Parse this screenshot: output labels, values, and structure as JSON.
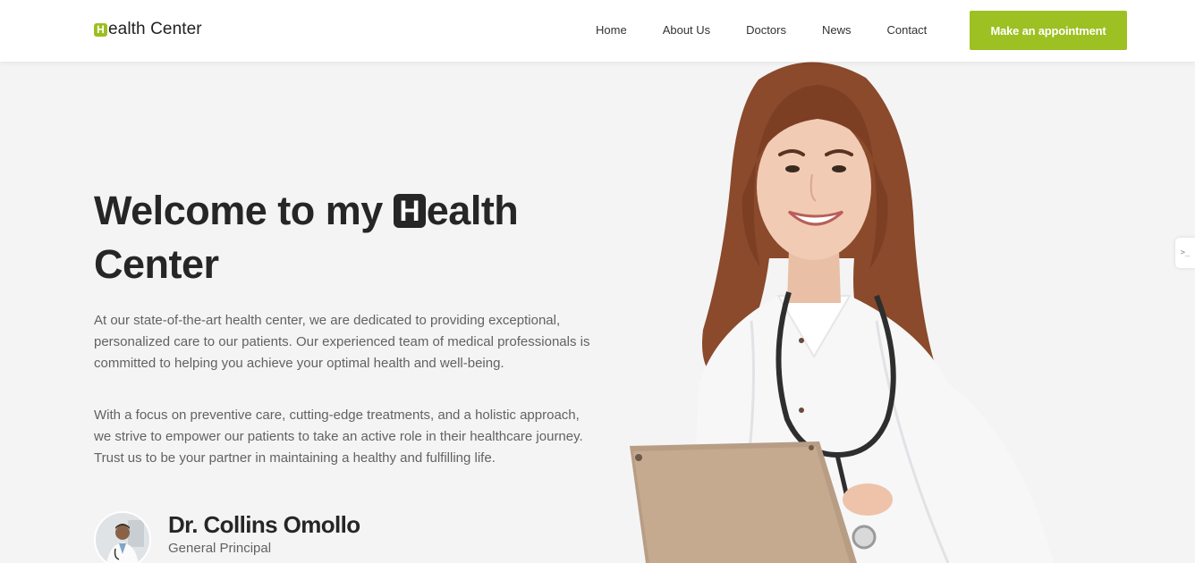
{
  "brand": {
    "letter": "H",
    "rest": "ealth Center",
    "accent_color": "#9dc022"
  },
  "nav": {
    "items": [
      {
        "label": "Home"
      },
      {
        "label": "About Us"
      },
      {
        "label": "Doctors"
      },
      {
        "label": "News"
      },
      {
        "label": "Contact"
      }
    ],
    "cta_label": "Make an appointment"
  },
  "hero": {
    "title_before": "Welcome to my ",
    "title_letter": "H",
    "title_after": "ealth Center",
    "paragraphs": [
      "At our state-of-the-art health center, we are dedicated to providing exceptional, personalized care to our patients. Our experienced team of medical professionals is committed to helping you achieve your optimal health and well-being.",
      "With a focus on preventive care, cutting-edge treatments, and a holistic approach, we strive to empower our patients to take an active role in their healthcare journey. Trust us to be your partner in maintaining a healthy and fulfilling life."
    ]
  },
  "author": {
    "name": "Dr. Collins Omollo",
    "role": "General Principal"
  },
  "side_tab": {
    "icon": "terminal-icon",
    "glyph": ">_"
  }
}
